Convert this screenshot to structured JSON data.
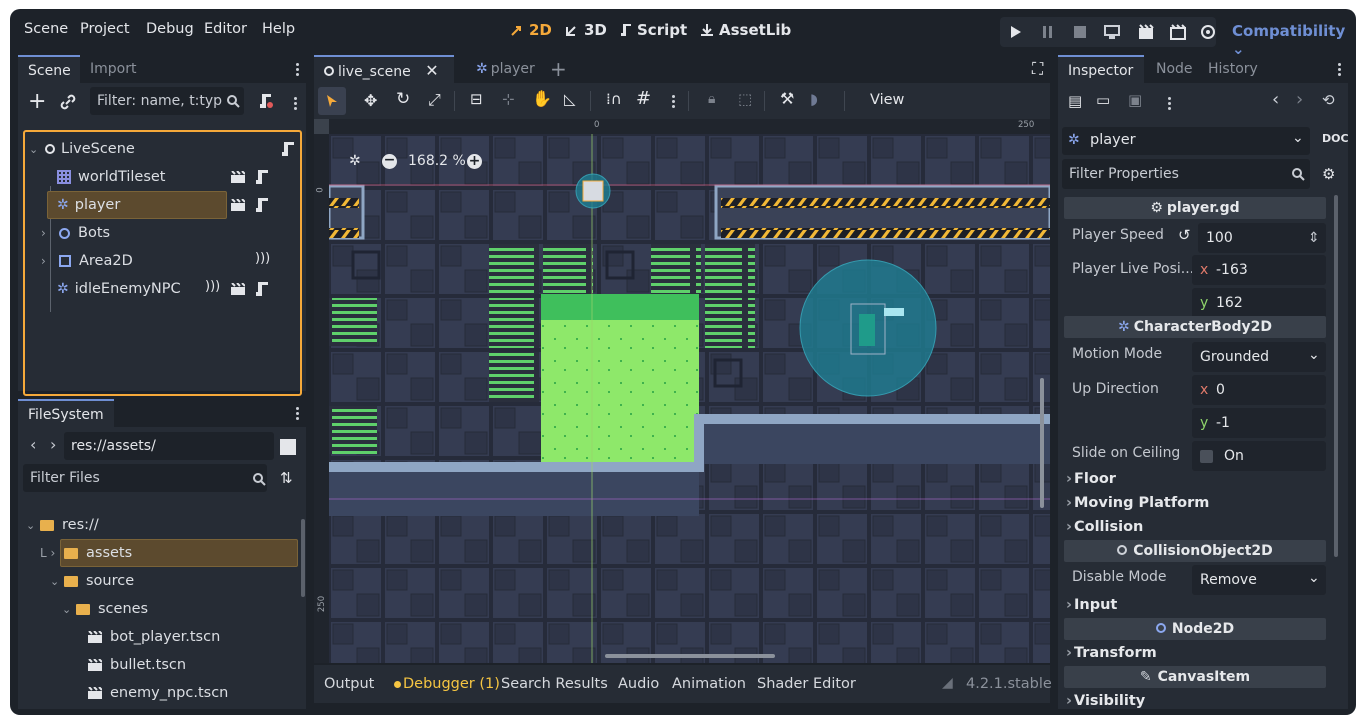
{
  "menu": [
    "Scene",
    "Project",
    "Debug",
    "Editor",
    "Help"
  ],
  "workspaces": {
    "two_d": "2D",
    "three_d": "3D",
    "script": "Script",
    "assetlib": "AssetLib"
  },
  "renderer": "Compatibility",
  "colors": {
    "accent": "#f5a93a",
    "blue": "#6f8fd4",
    "bg": "#1d2229",
    "panel": "#262c35",
    "selected": "#5c4a2e"
  },
  "scene_dock": {
    "tabs": [
      "Scene",
      "Import"
    ],
    "filter_placeholder": "Filter: name, t:typ",
    "tree": [
      {
        "label": "LiveScene",
        "icon": "node2d-icon"
      },
      {
        "label": "worldTileset",
        "icon": "tilemap-icon"
      },
      {
        "label": "player",
        "icon": "characterbody-icon"
      },
      {
        "label": "Bots",
        "icon": "node2d-icon"
      },
      {
        "label": "Area2D",
        "icon": "area2d-icon"
      },
      {
        "label": "idleEnemyNPC",
        "icon": "characterbody-icon"
      }
    ]
  },
  "filesystem": {
    "tab": "FileSystem",
    "path": "res://assets/",
    "filter_placeholder": "Filter Files",
    "items": [
      "res://",
      "assets",
      "source",
      "scenes",
      "bot_player.tscn",
      "bullet.tscn",
      "enemy_npc.tscn"
    ]
  },
  "editor": {
    "tabs": [
      "live_scene",
      "player"
    ],
    "view_label": "View",
    "zoom": "168.2 %",
    "ruler": {
      "top_zero": "0",
      "top_250": "250",
      "left_zero": "0",
      "left_250": "250"
    }
  },
  "bottom": {
    "tabs": [
      "Output",
      "Debugger (1)",
      "Search Results",
      "Audio",
      "Animation",
      "Shader Editor"
    ],
    "version": "4.2.1.stable"
  },
  "inspector": {
    "tabs": [
      "Inspector",
      "Node",
      "History"
    ],
    "object": "player",
    "filter_placeholder": "Filter Properties",
    "script_section": "player.gd",
    "player_speed_label": "Player Speed",
    "player_speed": "100",
    "live_pos_label": "Player Live Posi...",
    "live_pos_x": "-163",
    "live_pos_y": "162",
    "characterbody_section": "CharacterBody2D",
    "motion_mode_label": "Motion Mode",
    "motion_mode": "Grounded",
    "up_dir_label": "Up Direction",
    "up_x": "0",
    "up_y": "-1",
    "slide_label": "Slide on Ceiling",
    "slide_value": "On",
    "groups1": [
      "Floor",
      "Moving Platform",
      "Collision"
    ],
    "collision_section": "CollisionObject2D",
    "disable_mode_label": "Disable Mode",
    "disable_mode": "Remove",
    "input_group": "Input",
    "node2d_section": "Node2D",
    "transform_group": "Transform",
    "canvas_section": "CanvasItem",
    "visibility_group": "Visibility",
    "x_axis": "x",
    "y_axis": "y"
  }
}
